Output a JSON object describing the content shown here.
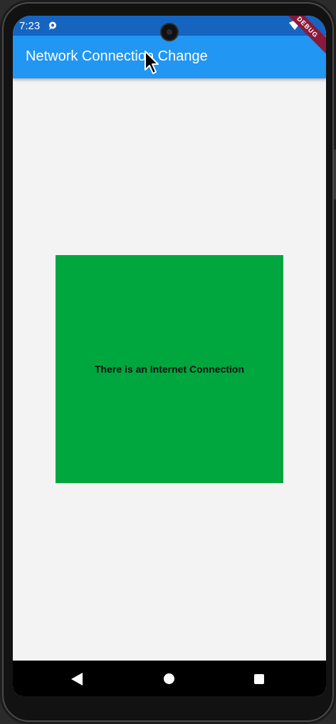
{
  "status_bar": {
    "time": "7:23",
    "background": "#1565c0"
  },
  "app_bar": {
    "title": "Network Connection Change",
    "background": "#2196f3"
  },
  "debug_banner": {
    "label": "DEBUG",
    "color": "#8b1a3a"
  },
  "main": {
    "status_text": "There is an Internet Connection",
    "box_color": "#00a73f"
  },
  "nav_bar": {
    "buttons": [
      "back-icon",
      "home-icon",
      "recents-icon"
    ]
  },
  "icons": {
    "notification": "notification-bubble-icon",
    "wifi": "wifi-icon",
    "signal": "signal-icon",
    "battery": "battery-icon",
    "cursor": "mouse-cursor-icon"
  }
}
